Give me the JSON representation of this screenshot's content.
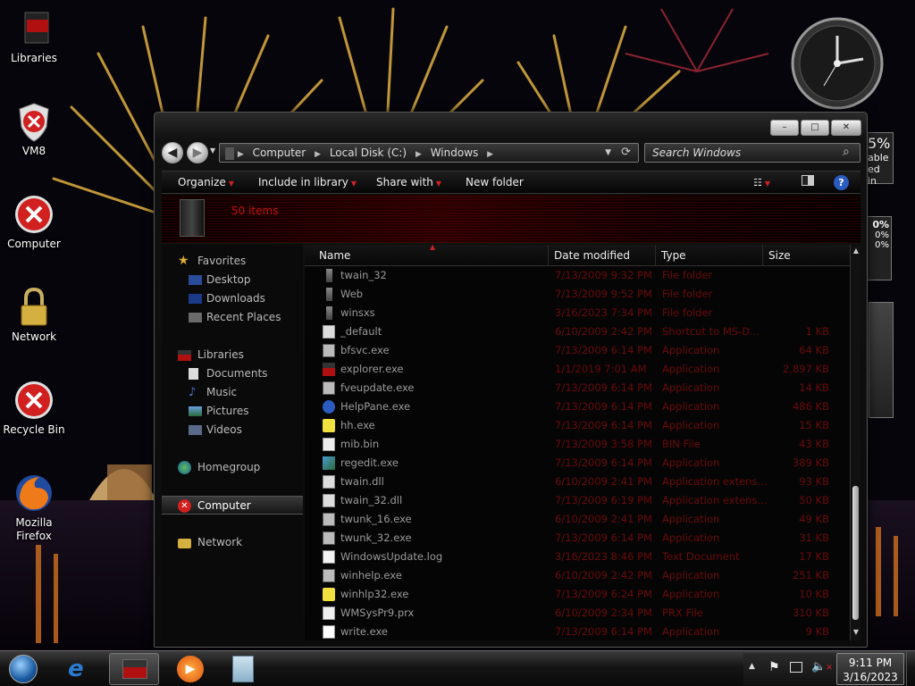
{
  "desktop": {
    "icons": [
      {
        "label": "Libraries",
        "icon": "libraries-icon"
      },
      {
        "label": "VM8",
        "icon": "shield-error-icon"
      },
      {
        "label": "Computer",
        "icon": "error-icon"
      },
      {
        "label": "Network",
        "icon": "lock-icon"
      },
      {
        "label": "Recycle Bin",
        "icon": "error-icon"
      },
      {
        "label": "Mozilla Firefox",
        "icon": "firefox-icon"
      }
    ],
    "gadget_fragments": {
      "cpu_label": "5%",
      "line1": "able",
      "line2": "ed in",
      "meter_a": "0%",
      "meter_b": "0%",
      "meter_c": "0%"
    }
  },
  "window": {
    "controls": {
      "minimize": "–",
      "maximize": "□",
      "close": "✕"
    },
    "breadcrumb": [
      "Computer",
      "Local Disk (C:)",
      "Windows"
    ],
    "search_placeholder": "Search Windows",
    "commands": [
      {
        "label": "Organize",
        "has_menu": true
      },
      {
        "label": "Include in library",
        "has_menu": true
      },
      {
        "label": "Share with",
        "has_menu": true
      },
      {
        "label": "New folder",
        "has_menu": false
      }
    ],
    "items_count": "50 items",
    "nav": {
      "favorites": {
        "label": "Favorites",
        "items": [
          "Desktop",
          "Downloads",
          "Recent Places"
        ]
      },
      "libraries": {
        "label": "Libraries",
        "items": [
          "Documents",
          "Music",
          "Pictures",
          "Videos"
        ]
      },
      "homegroup": "Homegroup",
      "computer": "Computer",
      "network": "Network"
    },
    "columns": [
      "Name",
      "Date modified",
      "Type",
      "Size"
    ],
    "files": [
      {
        "name": "twain_32",
        "date": "7/13/2009 9:32 PM",
        "type": "File folder",
        "size": "",
        "icon": "folder-icon"
      },
      {
        "name": "Web",
        "date": "7/13/2009 9:52 PM",
        "type": "File folder",
        "size": "",
        "icon": "folder-icon"
      },
      {
        "name": "winsxs",
        "date": "3/16/2023 7:34 PM",
        "type": "File folder",
        "size": "",
        "icon": "folder-icon"
      },
      {
        "name": "_default",
        "date": "6/10/2009 2:42 PM",
        "type": "Shortcut to MS-D...",
        "size": "1 KB",
        "icon": "shortcut-icon"
      },
      {
        "name": "bfsvc.exe",
        "date": "7/13/2009 6:14 PM",
        "type": "Application",
        "size": "64 KB",
        "icon": "app-icon"
      },
      {
        "name": "explorer.exe",
        "date": "1/1/2019 7:01 AM",
        "type": "Application",
        "size": "2,897 KB",
        "icon": "explorer-icon"
      },
      {
        "name": "fveupdate.exe",
        "date": "7/13/2009 6:14 PM",
        "type": "Application",
        "size": "14 KB",
        "icon": "app-icon"
      },
      {
        "name": "HelpPane.exe",
        "date": "7/13/2009 6:14 PM",
        "type": "Application",
        "size": "486 KB",
        "icon": "help-icon"
      },
      {
        "name": "hh.exe",
        "date": "7/13/2009 6:14 PM",
        "type": "Application",
        "size": "15 KB",
        "icon": "question-icon"
      },
      {
        "name": "mib.bin",
        "date": "7/13/2009 3:58 PM",
        "type": "BIN File",
        "size": "43 KB",
        "icon": "file-icon"
      },
      {
        "name": "regedit.exe",
        "date": "7/13/2009 6:14 PM",
        "type": "Application",
        "size": "389 KB",
        "icon": "registry-icon"
      },
      {
        "name": "twain.dll",
        "date": "6/10/2009 2:41 PM",
        "type": "Application extens...",
        "size": "93 KB",
        "icon": "dll-icon"
      },
      {
        "name": "twain_32.dll",
        "date": "7/13/2009 6:19 PM",
        "type": "Application extens...",
        "size": "50 KB",
        "icon": "dll-icon"
      },
      {
        "name": "twunk_16.exe",
        "date": "6/10/2009 2:41 PM",
        "type": "Application",
        "size": "49 KB",
        "icon": "app-icon"
      },
      {
        "name": "twunk_32.exe",
        "date": "7/13/2009 6:14 PM",
        "type": "Application",
        "size": "31 KB",
        "icon": "app-icon"
      },
      {
        "name": "WindowsUpdate.log",
        "date": "3/16/2023 8:46 PM",
        "type": "Text Document",
        "size": "17 KB",
        "icon": "text-file-icon"
      },
      {
        "name": "winhelp.exe",
        "date": "6/10/2009 2:42 PM",
        "type": "Application",
        "size": "251 KB",
        "icon": "app-icon"
      },
      {
        "name": "winhlp32.exe",
        "date": "7/13/2009 6:24 PM",
        "type": "Application",
        "size": "10 KB",
        "icon": "question-icon"
      },
      {
        "name": "WMSysPr9.prx",
        "date": "6/10/2009 2:34 PM",
        "type": "PRX File",
        "size": "310 KB",
        "icon": "file-icon"
      },
      {
        "name": "write.exe",
        "date": "7/13/2009 6:14 PM",
        "type": "Application",
        "size": "9 KB",
        "icon": "write-icon"
      }
    ]
  },
  "taskbar": {
    "pinned": [
      "start-orb-icon",
      "internet-explorer-icon",
      "explorer-icon",
      "media-player-icon",
      "notepad-icon"
    ],
    "clock": {
      "time": "9:11 PM",
      "date": "3/16/2023"
    },
    "tray_icons": [
      "show-hidden-icon",
      "flag-icon",
      "network-icon",
      "volume-muted-icon"
    ]
  },
  "colors": {
    "accent_red": "#c21010",
    "dim_red": "#6a0a0a",
    "window_bg": "#0b0b0b"
  }
}
